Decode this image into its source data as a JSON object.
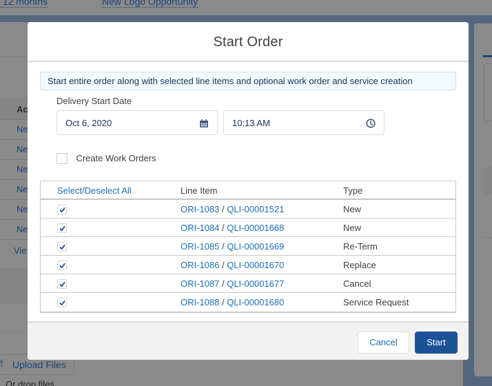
{
  "background": {
    "top_links": [
      "/ 12 months",
      "New Logo Opportunity"
    ],
    "left_column_header": "Ac",
    "left_rows": [
      "Ne",
      "Ne",
      "Ne",
      "Ne",
      "Ne",
      "Ne",
      "Vie"
    ],
    "upload_files_label": "Upload Files",
    "drop_files_label": "Or drop files"
  },
  "modal": {
    "title": "Start Order",
    "info_text": "Start entire order along with selected line items and optional work order and service creation",
    "delivery_start_date_label": "Delivery Start Date",
    "date_value": "Oct 6, 2020",
    "time_value": "10:13 AM",
    "create_work_orders": {
      "label": "Create Work Orders",
      "checked": false
    },
    "table": {
      "headers": {
        "select": "Select/Deselect All",
        "line_item": "Line Item",
        "type": "Type"
      },
      "rows": [
        {
          "checked": true,
          "order_item": "ORI-1083",
          "quote_item": "QLI-00001521",
          "type": "New"
        },
        {
          "checked": true,
          "order_item": "ORI-1084",
          "quote_item": "QLI-00001668",
          "type": "New"
        },
        {
          "checked": true,
          "order_item": "ORI-1085",
          "quote_item": "QLI-00001669",
          "type": "Re-Term"
        },
        {
          "checked": true,
          "order_item": "ORI-1086",
          "quote_item": "QLI-00001670",
          "type": "Replace"
        },
        {
          "checked": true,
          "order_item": "ORI-1087",
          "quote_item": "QLI-00001677",
          "type": "Cancel"
        },
        {
          "checked": true,
          "order_item": "ORI-1088",
          "quote_item": "QLI-00001680",
          "type": "Service Request"
        }
      ],
      "separator": "/"
    },
    "footer": {
      "cancel_label": "Cancel",
      "start_label": "Start"
    }
  },
  "colors": {
    "brand": "#1b5297",
    "link": "#1b6eb9",
    "info_bg": "#f3fafe"
  }
}
